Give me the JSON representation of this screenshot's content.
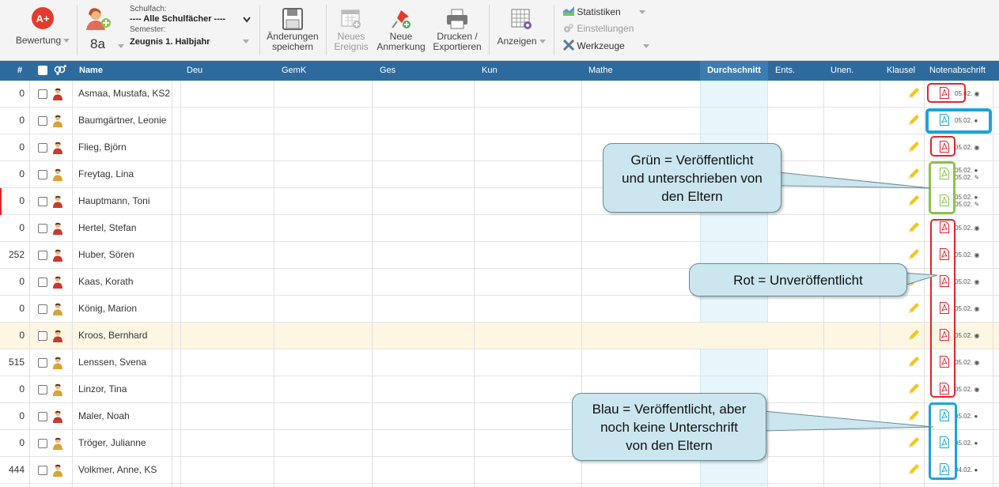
{
  "toolbar": {
    "bewertung_label": "Bewertung",
    "class_label": "8a",
    "schulfach_label": "Schulfach:",
    "schulfach_value": "---- Alle Schulfächer ----",
    "semester_label": "Semester:",
    "semester_value": "Zeugnis 1. Halbjahr",
    "save_line1": "Änderungen",
    "save_line2": "speichern",
    "event_line1": "Neues",
    "event_line2": "Ereignis",
    "note_line1": "Neue",
    "note_line2": "Anmerkung",
    "print_line1": "Drucken /",
    "print_line2": "Exportieren",
    "anzeigen_label": "Anzeigen",
    "statistiken_label": "Statistiken",
    "einstellungen_label": "Einstellungen",
    "werkzeuge_label": "Werkzeuge"
  },
  "columns": {
    "num": "#",
    "name": "Name",
    "deu": "Deu",
    "gemk": "GemK",
    "ges": "Ges",
    "kun": "Kun",
    "mathe": "Mathe",
    "durchschnitt": "Durchschnitt",
    "ents": "Ents.",
    "unen": "Unen.",
    "klausel": "Klausel",
    "notenabschrift": "Notenabschrift"
  },
  "rows": [
    {
      "num": "0",
      "name": "Asmaa, Mustafa, KS2",
      "date": "05.02.",
      "date2": "",
      "status": "red"
    },
    {
      "num": "0",
      "name": "Baumgärtner, Leonie",
      "date": "05.02.",
      "date2": "",
      "status": "blue"
    },
    {
      "num": "0",
      "name": "Flieg, Björn",
      "date": "05.02.",
      "date2": "",
      "status": "red"
    },
    {
      "num": "0",
      "name": "Freytag, Lina",
      "date": "05.02.",
      "date2": "05.02.",
      "status": "green"
    },
    {
      "num": "0",
      "name": "Hauptmann, Toni",
      "date": "05.02.",
      "date2": "05.02.",
      "status": "green"
    },
    {
      "num": "0",
      "name": "Hertel, Stefan",
      "date": "05.02.",
      "date2": "",
      "status": "red"
    },
    {
      "num": "252",
      "name": "Huber, Sören",
      "date": "05.02.",
      "date2": "",
      "status": "red"
    },
    {
      "num": "0",
      "name": "Kaas, Korath",
      "date": "05.02.",
      "date2": "",
      "status": "red"
    },
    {
      "num": "0",
      "name": "König, Marion",
      "date": "05.02.",
      "date2": "",
      "status": "red"
    },
    {
      "num": "0",
      "name": "Kroos, Bernhard",
      "date": "05.02.",
      "date2": "",
      "status": "red"
    },
    {
      "num": "515",
      "name": "Lenssen, Svena",
      "date": "05.02.",
      "date2": "",
      "status": "red"
    },
    {
      "num": "0",
      "name": "Linzor, Tina",
      "date": "05.02.",
      "date2": "",
      "status": "red"
    },
    {
      "num": "0",
      "name": "Maler, Noah",
      "date": "05.02.",
      "date2": "",
      "status": "blue"
    },
    {
      "num": "0",
      "name": "Tröger, Julianne",
      "date": "05.02.",
      "date2": "",
      "status": "blue"
    },
    {
      "num": "444",
      "name": "Volkmer, Anne, KS",
      "date": "04.02.",
      "date2": "",
      "status": "blue"
    }
  ],
  "callouts": {
    "green_line1": "Grün = Veröffentlicht",
    "green_line2": "und unterschrieben von",
    "green_line3": "den Eltern",
    "red": "Rot = Unveröffentlicht",
    "blue_line1": "Blau = Veröffentlicht, aber",
    "blue_line2": "noch keine Unterschrift",
    "blue_line3": "von den Eltern"
  },
  "colors": {
    "header_bg": "#2d6b9e",
    "red": "#e0262a",
    "green": "#8bc34a",
    "blue": "#1aa3dc",
    "highlight_row": "#fcf6e2",
    "avg_column": "#e6f6fb"
  }
}
